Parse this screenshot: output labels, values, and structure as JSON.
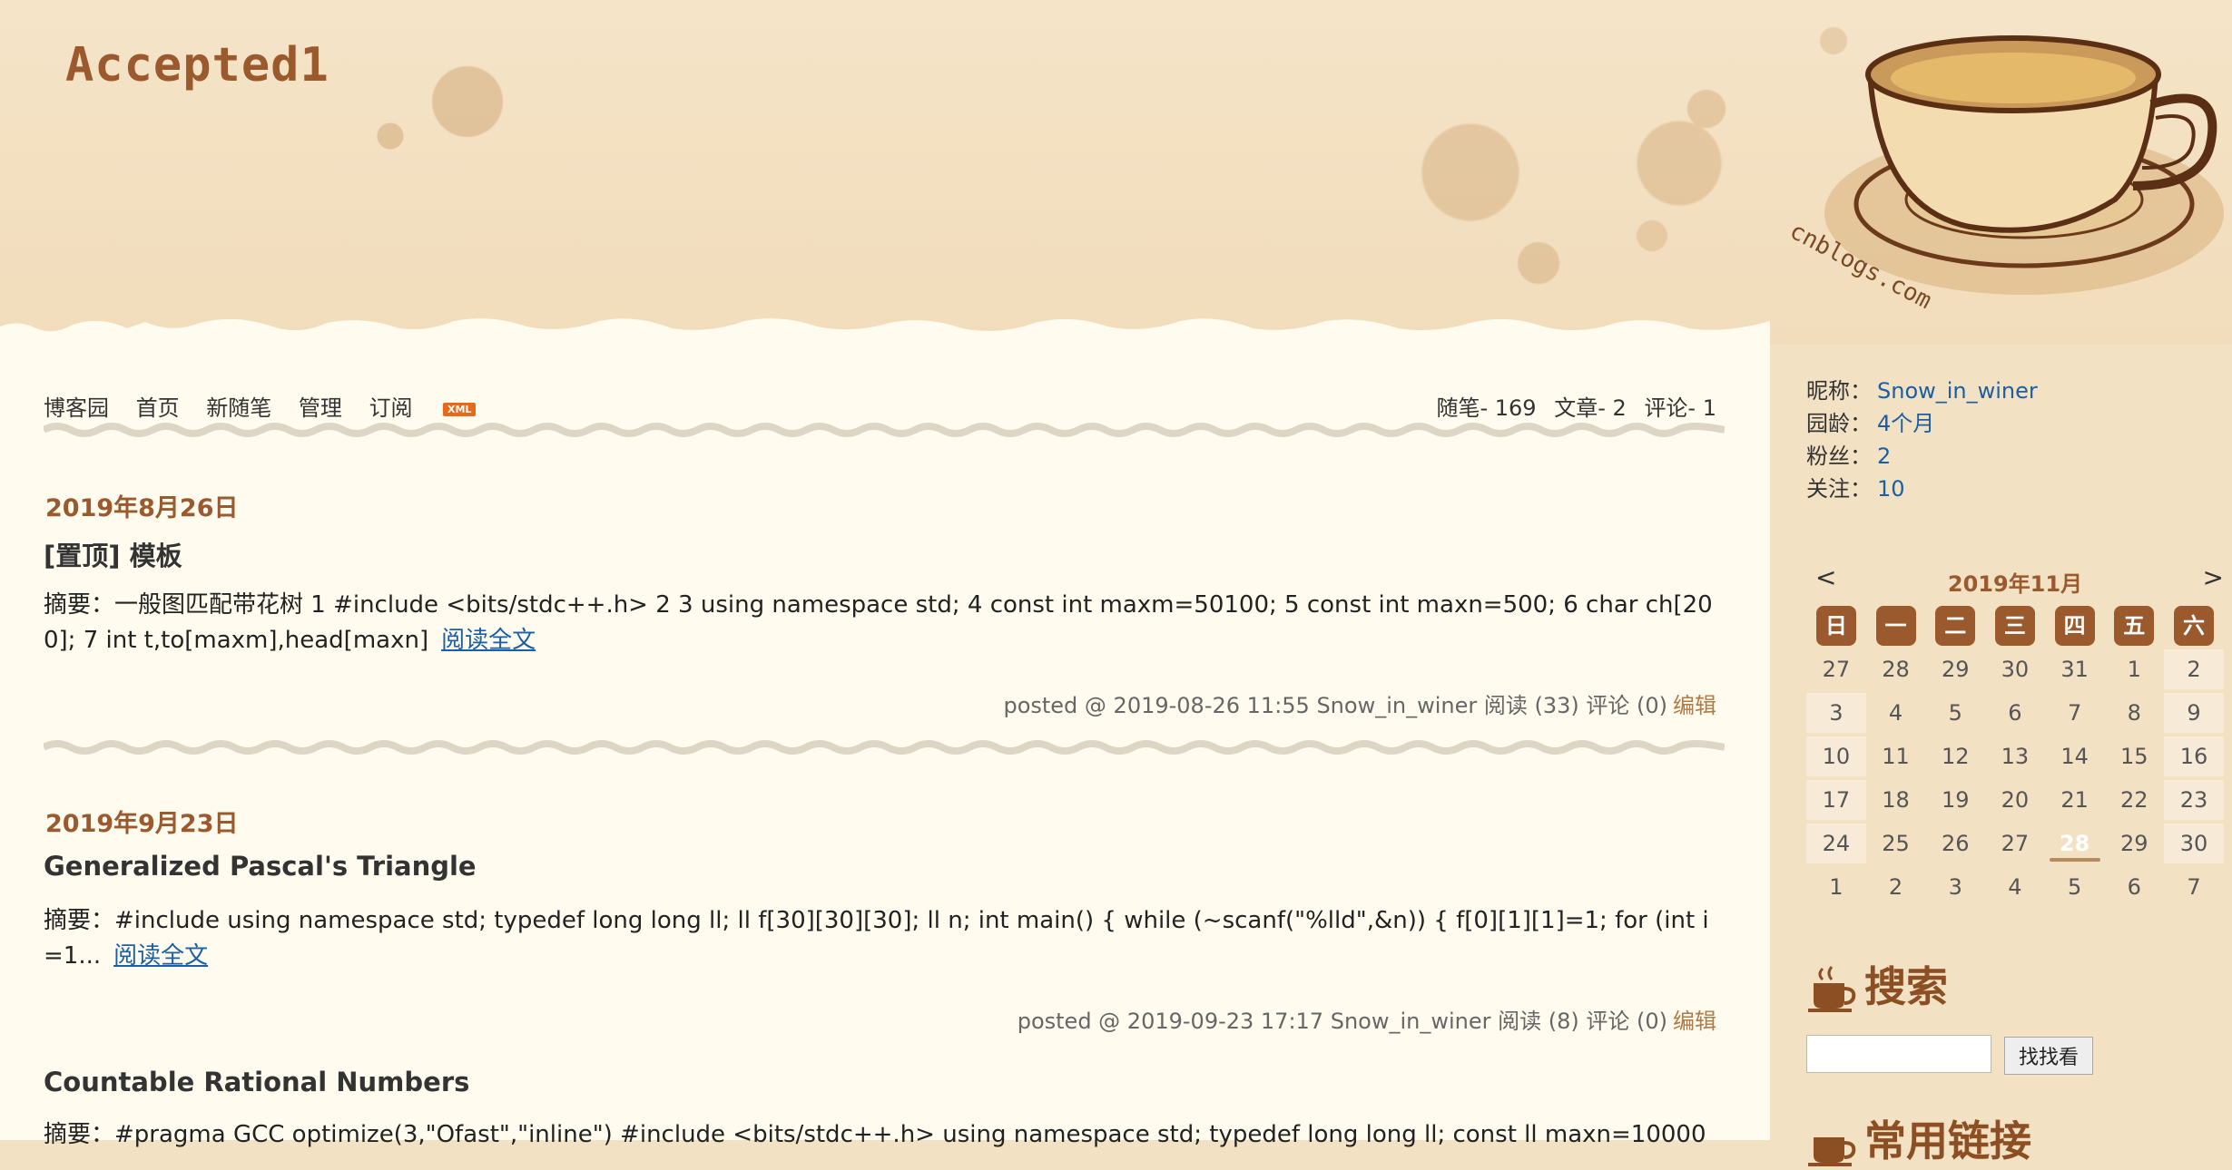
{
  "blog": {
    "title": "Accepted1"
  },
  "nav": {
    "items": [
      "博客园",
      "首页",
      "新随笔",
      "管理",
      "订阅"
    ],
    "xml": "XML"
  },
  "stats": {
    "posts": "随笔- 169",
    "articles": "文章- 2",
    "comments": "评论- 1"
  },
  "posts": [
    {
      "day": "2019年8月26日",
      "title": "[置顶] 模板",
      "summary": "摘要：一般图匹配带花树 1 #include <bits/stdc++.h> 2 3 using namespace std; 4 const int maxm=50100; 5 const int maxn=500; 6 char ch[200]; 7 int t,to[maxm],head[maxn]",
      "read_more": "阅读全文",
      "desc": "posted @ 2019-08-26 11:55 Snow_in_winer 阅读 (33) 评论 (0)",
      "edit": "编辑"
    },
    {
      "day": "2019年9月23日",
      "title": "Generalized Pascal's Triangle",
      "summary": "摘要：#include using namespace std; typedef long long ll; ll f[30][30][30]; ll n; int main() { while (~scanf(\"%lld\",&n)) { f[0][1][1]=1; for (int i=1...",
      "read_more": "阅读全文",
      "desc": "posted @ 2019-09-23 17:17 Snow_in_winer 阅读 (8) 评论 (0)",
      "edit": "编辑"
    },
    {
      "title": "Countable Rational Numbers",
      "summary": "摘要：#pragma GCC optimize(3,\"Ofast\",\"inline\") #include <bits/stdc++.h> using namespace std; typedef long long ll; const ll maxn=10000"
    }
  ],
  "profile": {
    "nickname_label": "昵称：",
    "nickname": "Snow_in_winer",
    "age_label": "园龄：",
    "age": "4个月",
    "fans_label": "粉丝：",
    "fans": "2",
    "follow_label": "关注：",
    "follow": "10"
  },
  "calendar": {
    "prev": "<",
    "next": ">",
    "month": "2019年11月",
    "weekdays": [
      "日",
      "一",
      "二",
      "三",
      "四",
      "五",
      "六"
    ],
    "days": [
      [
        "27",
        "28",
        "29",
        "30",
        "31",
        "1",
        "2"
      ],
      [
        "3",
        "4",
        "5",
        "6",
        "7",
        "8",
        "9"
      ],
      [
        "10",
        "11",
        "12",
        "13",
        "14",
        "15",
        "16"
      ],
      [
        "17",
        "18",
        "19",
        "20",
        "21",
        "22",
        "23"
      ],
      [
        "24",
        "25",
        "26",
        "27",
        "28",
        "29",
        "30"
      ],
      [
        "1",
        "2",
        "3",
        "4",
        "5",
        "6",
        "7"
      ]
    ],
    "today": "28"
  },
  "search": {
    "title": "搜索",
    "button": "找找看",
    "placeholder": ""
  },
  "links": {
    "title": "常用链接"
  }
}
